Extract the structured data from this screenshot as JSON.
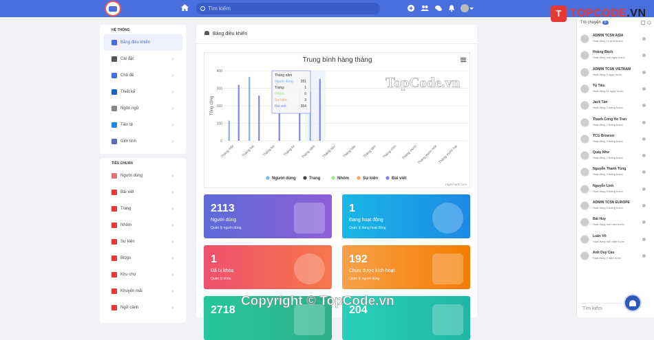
{
  "topbar": {
    "search_placeholder": "Tìm kiếm"
  },
  "brand": {
    "mark": "T",
    "name_red": "TOPCODE",
    "name_dark": ".VN"
  },
  "sidebar": {
    "section1": "Hệ thống",
    "items1": [
      {
        "label": "Bảng điều khiển",
        "icon": "dashboard-icon",
        "color": "#4a6fdc"
      },
      {
        "label": "Cài đặt",
        "icon": "gear-icon",
        "color": "#555"
      },
      {
        "label": "Chủ đề",
        "icon": "monitor-icon",
        "color": "#4a6fdc"
      },
      {
        "label": "Thiết kế",
        "icon": "brush-icon",
        "color": "#1565c0"
      },
      {
        "label": "Ngôn ngữ",
        "icon": "language-icon",
        "color": "#888"
      },
      {
        "label": "Tiền tệ",
        "icon": "money-icon",
        "color": "#1e88e5"
      },
      {
        "label": "Giới tính",
        "icon": "gender-icon",
        "color": "#5c6bc0"
      }
    ],
    "section2": "Tiêu chuẩn",
    "items2": [
      {
        "label": "Người dùng",
        "icon": "users-icon",
        "color": "#e57373"
      },
      {
        "label": "Bài viết",
        "icon": "newspaper-icon",
        "color": "#e53935"
      },
      {
        "label": "Trang",
        "icon": "flag-icon",
        "color": "#e53935"
      },
      {
        "label": "Nhóm",
        "icon": "group-icon",
        "color": "#e53935"
      },
      {
        "label": "Sự kiện",
        "icon": "calendar-icon",
        "color": "#e53935"
      },
      {
        "label": "Blogs",
        "icon": "blog-icon",
        "color": "#e53935"
      },
      {
        "label": "Khu chợ",
        "icon": "shop-icon",
        "color": "#e53935"
      },
      {
        "label": "Khuyến mãi",
        "icon": "tag-icon",
        "color": "#e53935"
      },
      {
        "label": "Ngữ cảnh",
        "icon": "context-icon",
        "color": "#e53935"
      }
    ]
  },
  "main": {
    "title": "Bảng điều khiển"
  },
  "chart_data": {
    "type": "bar",
    "title": "Trung bình hàng tháng",
    "ylabel": "Tổng cộng",
    "ylim": [
      0,
      400
    ],
    "yticks": [
      0,
      100,
      200,
      300,
      400
    ],
    "credits": "Highcharts.com",
    "categories": [
      "Tháng một",
      "Tháng hai",
      "Tháng ba",
      "Tháng tư",
      "Tháng năm",
      "Tháng sáu",
      "Tháng bảy",
      "Tháng tám",
      "Tháng chín",
      "Tháng mười",
      "Tháng mười một",
      "Tháng mười hai"
    ],
    "series": [
      {
        "name": "Người dùng",
        "color": "#7cb5ec",
        "values": [
          115,
          365,
          0,
          0,
          281,
          0,
          0,
          0,
          0,
          0,
          0,
          0
        ]
      },
      {
        "name": "Trang",
        "color": "#434348",
        "values": [
          0,
          0,
          0,
          0,
          1,
          0,
          0,
          0,
          0,
          0,
          0,
          0
        ]
      },
      {
        "name": "Nhóm",
        "color": "#90ed7d",
        "values": [
          0,
          0,
          0,
          0,
          0,
          0,
          0,
          0,
          0,
          0,
          0,
          0
        ]
      },
      {
        "name": "Sự kiện",
        "color": "#f7a35c",
        "values": [
          0,
          0,
          0,
          0,
          3,
          0,
          0,
          0,
          0,
          0,
          0,
          0
        ]
      },
      {
        "name": "Bài viết",
        "color": "#8085e9",
        "values": [
          320,
          258,
          320,
          290,
          354,
          0,
          0,
          0,
          0,
          0,
          0,
          0
        ]
      }
    ],
    "tooltip": {
      "title": "Tháng năm",
      "rows": [
        {
          "label": "Người dùng",
          "value": "281",
          "color": "#7cb5ec"
        },
        {
          "label": "Trang",
          "value": "1",
          "color": "#434348"
        },
        {
          "label": "Nhóm",
          "value": "0",
          "color": "#90ed7d"
        },
        {
          "label": "Sự kiện",
          "value": "3",
          "color": "#f7a35c"
        },
        {
          "label": "Bài viết",
          "value": "354",
          "color": "#8085e9"
        }
      ]
    }
  },
  "stats": [
    {
      "value": "2113",
      "label": "Người dùng",
      "sub": "Quản lý người dùng",
      "icon": "users-icon",
      "from": "#5c6bd8",
      "to": "#8e5fd8"
    },
    {
      "value": "1",
      "label": "Đang hoạt động",
      "sub": "Quản lý đang hoạt động",
      "icon": "clock-icon",
      "from": "#17b8e6",
      "to": "#1e88e5"
    },
    {
      "value": "1",
      "label": "Đã bị khóa",
      "sub": "Quản lý khóa",
      "icon": "minus-circle-icon",
      "from": "#f0506e",
      "to": "#f5774a"
    },
    {
      "value": "192",
      "label": "Chưa được kích hoạt",
      "sub": "Quản lý người dùng",
      "icon": "envelope-icon",
      "from": "#f7a14a",
      "to": "#f57c00"
    },
    {
      "value": "2718",
      "label": "",
      "sub": "",
      "icon": "blank-icon",
      "from": "#26c79a",
      "to": "#2eb08a"
    },
    {
      "value": "204",
      "label": "",
      "sub": "",
      "icon": "blank-icon",
      "from": "#2ad0b8",
      "to": "#1fb7a3"
    }
  ],
  "friends": {
    "title": "Trò chuyện",
    "count": "0",
    "list": [
      {
        "name": "ADMIN TCSN ASIA",
        "status": "Hoạt động 12 phút trước"
      },
      {
        "name": "Hoàng Bách",
        "status": "Hoạt động một ngày trước"
      },
      {
        "name": "ADMIN TCSN VIETNAM",
        "status": "Hoạt động 4 ngày trước"
      },
      {
        "name": "Tú Tiêu",
        "status": "Hoạt động 11 ngày trước"
      },
      {
        "name": "Jack Tân",
        "status": "Hoạt động 3 tháng trước"
      },
      {
        "name": "Thanh Cong Ho Tran",
        "status": "Hoạt động 2 tháng trước"
      },
      {
        "name": "TCG Browser",
        "status": "Hoạt động 3 tháng trước"
      },
      {
        "name": "Quảy Như",
        "status": "Hoạt động 2 tháng trước"
      },
      {
        "name": "Nguyễn Thanh Tùng",
        "status": "Hoạt động 3 tháng trước"
      },
      {
        "name": "Nguyễn Linh",
        "status": "Hoạt động 3 tháng trước"
      },
      {
        "name": "ADMIN TCSN EUROPE",
        "status": "Hoạt động 5 tháng trước"
      },
      {
        "name": "Bất Huy",
        "status": "Hoạt động một năm trước"
      },
      {
        "name": "Luân Võ",
        "status": "Hoạt động một năm trước"
      },
      {
        "name": "Anh Duy Cao",
        "status": "Hoạt động 2 năm trước"
      }
    ],
    "search_placeholder": "Tìm kiếm"
  },
  "watermarks": {
    "center": "TopCode.vn",
    "bottom": "Copyright © TopCode.vn"
  }
}
